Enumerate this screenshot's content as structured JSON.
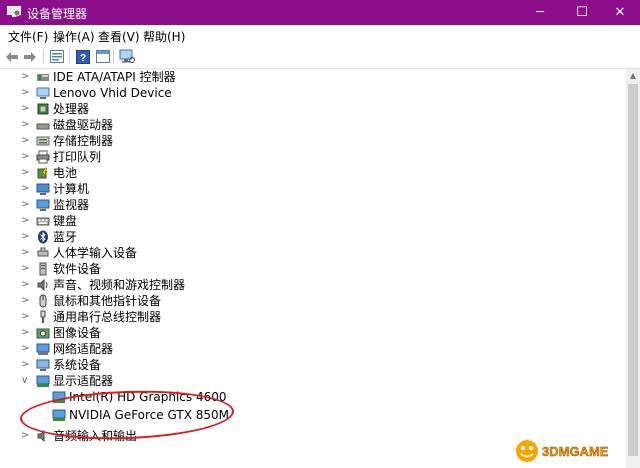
{
  "window": {
    "title": "设备管理器",
    "icon": "device-manager-icon",
    "controls": {
      "minimize": "─",
      "maximize": "☐",
      "close": "✕"
    }
  },
  "menu": {
    "file": "文件(F)",
    "action": "操作(A)",
    "view": "查看(V)",
    "help": "帮助(H)"
  },
  "toolbar": [
    "back-arrow-icon",
    "forward-arrow-icon",
    "properties-icon",
    "help-icon",
    "panel-icon",
    "monitor-scan-icon"
  ],
  "tree": {
    "categories": [
      {
        "label": "IDE ATA/ATAPI 控制器",
        "icon": "ide-controller-icon",
        "expanded": false
      },
      {
        "label": "Lenovo Vhid Device",
        "icon": "hid-device-icon",
        "expanded": false
      },
      {
        "label": "处理器",
        "icon": "processor-icon",
        "expanded": false
      },
      {
        "label": "磁盘驱动器",
        "icon": "disk-drive-icon",
        "expanded": false
      },
      {
        "label": "存储控制器",
        "icon": "storage-controller-icon",
        "expanded": false
      },
      {
        "label": "打印队列",
        "icon": "printer-icon",
        "expanded": false
      },
      {
        "label": "电池",
        "icon": "battery-icon",
        "expanded": false
      },
      {
        "label": "计算机",
        "icon": "computer-icon",
        "expanded": false
      },
      {
        "label": "监视器",
        "icon": "monitor-icon",
        "expanded": false
      },
      {
        "label": "键盘",
        "icon": "keyboard-icon",
        "expanded": false
      },
      {
        "label": "蓝牙",
        "icon": "bluetooth-icon",
        "expanded": false
      },
      {
        "label": "人体学输入设备",
        "icon": "hid-icon",
        "expanded": false
      },
      {
        "label": "软件设备",
        "icon": "software-device-icon",
        "expanded": false
      },
      {
        "label": "声音、视频和游戏控制器",
        "icon": "sound-icon",
        "expanded": false
      },
      {
        "label": "鼠标和其他指针设备",
        "icon": "mouse-icon",
        "expanded": false
      },
      {
        "label": "通用串行总线控制器",
        "icon": "usb-icon",
        "expanded": false
      },
      {
        "label": "图像设备",
        "icon": "camera-icon",
        "expanded": false
      },
      {
        "label": "网络适配器",
        "icon": "network-adapter-icon",
        "expanded": false
      },
      {
        "label": "系统设备",
        "icon": "system-device-icon",
        "expanded": false
      },
      {
        "label": "显示适配器",
        "icon": "display-adapter-icon",
        "expanded": true
      }
    ],
    "display_children": [
      {
        "label": "Intel(R) HD Graphics 4600",
        "icon": "display-adapter-icon"
      },
      {
        "label": "NVIDIA GeForce GTX 850M",
        "icon": "display-adapter-icon"
      }
    ],
    "last_category": {
      "label": "音频输入和输出",
      "icon": "audio-io-icon",
      "expanded": false
    }
  },
  "watermark": {
    "text": "3DMGAME"
  },
  "colors": {
    "titlebar": "#8b0f8b",
    "highlight": "#d62020"
  }
}
